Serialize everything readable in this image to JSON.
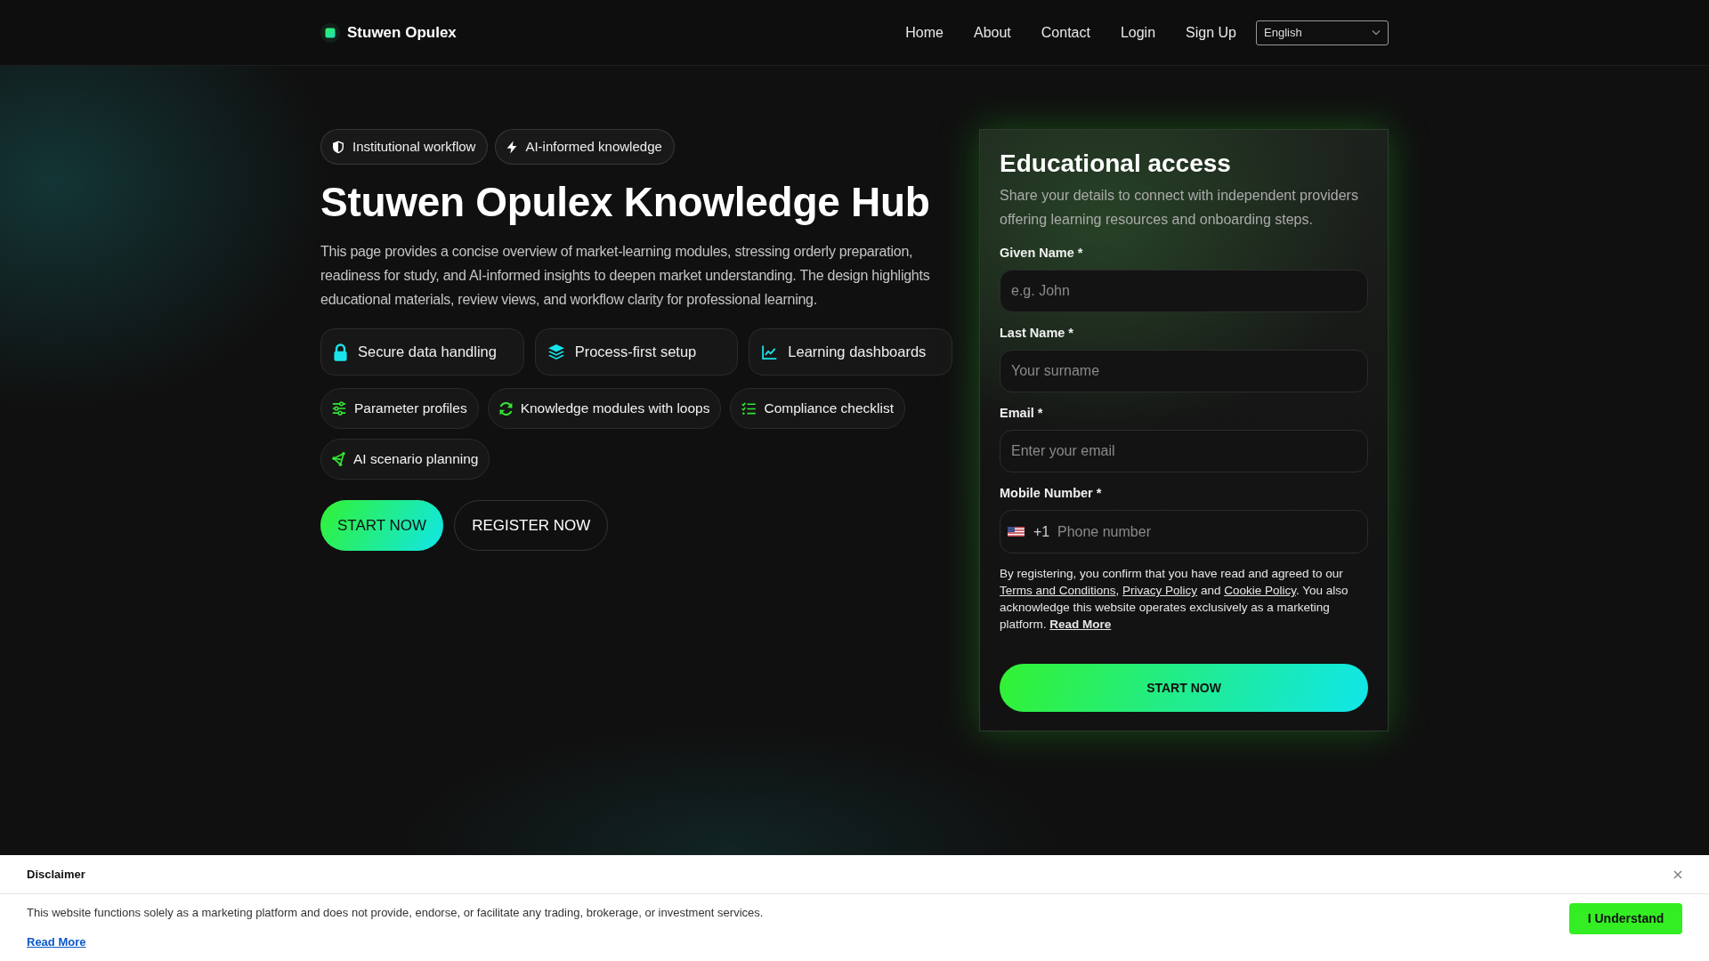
{
  "header": {
    "brand": "Stuwen Opulex",
    "nav": [
      "Home",
      "About",
      "Contact",
      "Login",
      "Sign Up"
    ],
    "language": "English"
  },
  "hero": {
    "badges": [
      "Institutional workflow",
      "AI-informed knowledge"
    ],
    "title": "Stuwen Opulex Knowledge Hub",
    "description": "This page provides a concise overview of market-learning modules, stressing orderly preparation, readiness for study, and AI-informed insights to deepen market understanding. The design highlights educational materials, review views, and workflow clarity for professional learning.",
    "highlights": [
      "Secure data handling",
      "Process-first setup",
      "Learning dashboards"
    ],
    "capabilities": [
      "Parameter profiles",
      "Knowledge modules with loops",
      "Compliance checklist",
      "AI scenario planning"
    ],
    "buttons": [
      {
        "kind": "primary",
        "label": "START NOW"
      },
      {
        "kind": "outline",
        "label": "REGISTER NOW"
      }
    ]
  },
  "form": {
    "title": "Educational access",
    "subtitle": "Share your details to connect with independent providers offering learning resources and onboarding steps.",
    "fields": [
      {
        "kind": "text",
        "label": "Given Name *",
        "placeholder": "e.g. John"
      },
      {
        "kind": "text",
        "label": "Last Name *",
        "placeholder": "Your surname"
      },
      {
        "kind": "text",
        "label": "Email *",
        "placeholder": "Enter your email"
      },
      {
        "kind": "phone",
        "label": "Mobile Number *",
        "prefix": "+1",
        "placeholder": "Phone number"
      }
    ],
    "consent": [
      {
        "kind": "text",
        "text": "By registering, you confirm that you have read and agreed to our "
      },
      {
        "kind": "link",
        "text": "Terms and Conditions"
      },
      {
        "kind": "text",
        "text": ", "
      },
      {
        "kind": "link",
        "text": "Privacy Policy"
      },
      {
        "kind": "text",
        "text": " and "
      },
      {
        "kind": "link",
        "text": "Cookie Policy"
      },
      {
        "kind": "text",
        "text": ". You also acknowledge this website operates exclusively as a marketing platform. "
      },
      {
        "kind": "more",
        "text": "Read More"
      }
    ],
    "submit": "START NOW"
  },
  "disclaimer": {
    "title": "Disclaimer",
    "text": "This website functions solely as a marketing platform and does not provide, endorse, or facilitate any trading, brokerage, or investment services.",
    "link": "Read More",
    "button": "I Understand"
  }
}
